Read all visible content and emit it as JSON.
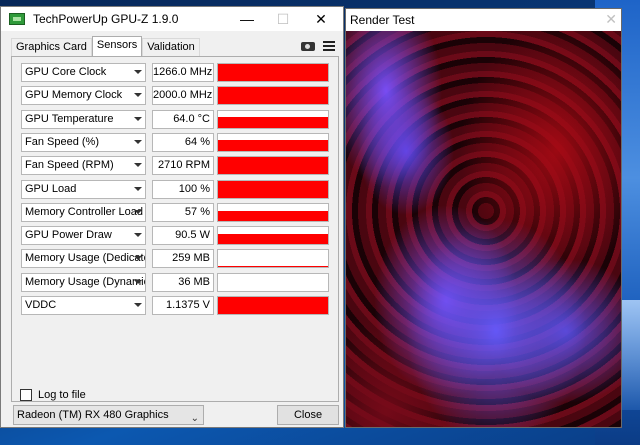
{
  "gpuz": {
    "title": "TechPowerUp GPU-Z 1.9.0",
    "tabs": [
      {
        "label": "Graphics Card",
        "active": false
      },
      {
        "label": "Sensors",
        "active": true
      },
      {
        "label": "Validation",
        "active": false
      }
    ],
    "icons": {
      "app": "gpuz-app-icon",
      "camera": "camera-icon",
      "menu": "hamburger-menu-icon"
    },
    "sensors": [
      {
        "name": "GPU Core Clock",
        "value": "1266.0 MHz",
        "fill_pct": 100
      },
      {
        "name": "GPU Memory Clock",
        "value": "2000.0 MHz",
        "fill_pct": 100
      },
      {
        "name": "GPU Temperature",
        "value": "64.0 °C",
        "fill_pct": 64
      },
      {
        "name": "Fan Speed (%)",
        "value": "64 %",
        "fill_pct": 64
      },
      {
        "name": "Fan Speed (RPM)",
        "value": "2710 RPM",
        "fill_pct": 100
      },
      {
        "name": "GPU Load",
        "value": "100 %",
        "fill_pct": 100
      },
      {
        "name": "Memory Controller Load",
        "value": "57 %",
        "fill_pct": 57
      },
      {
        "name": "GPU Power Draw",
        "value": "90.5 W",
        "fill_pct": 60
      },
      {
        "name": "Memory Usage (Dedicated)",
        "value": "259 MB",
        "fill_pct": 5
      },
      {
        "name": "Memory Usage (Dynamic)",
        "value": "36 MB",
        "fill_pct": 0
      },
      {
        "name": "VDDC",
        "value": "1.1375 V",
        "fill_pct": 100
      }
    ],
    "log_to_file": {
      "label": "Log to file",
      "checked": false
    },
    "device": "Radeon (TM) RX 480 Graphics",
    "close_label": "Close",
    "colors": {
      "graph": "#ff0000"
    }
  },
  "render_test": {
    "title": "Render Test"
  }
}
